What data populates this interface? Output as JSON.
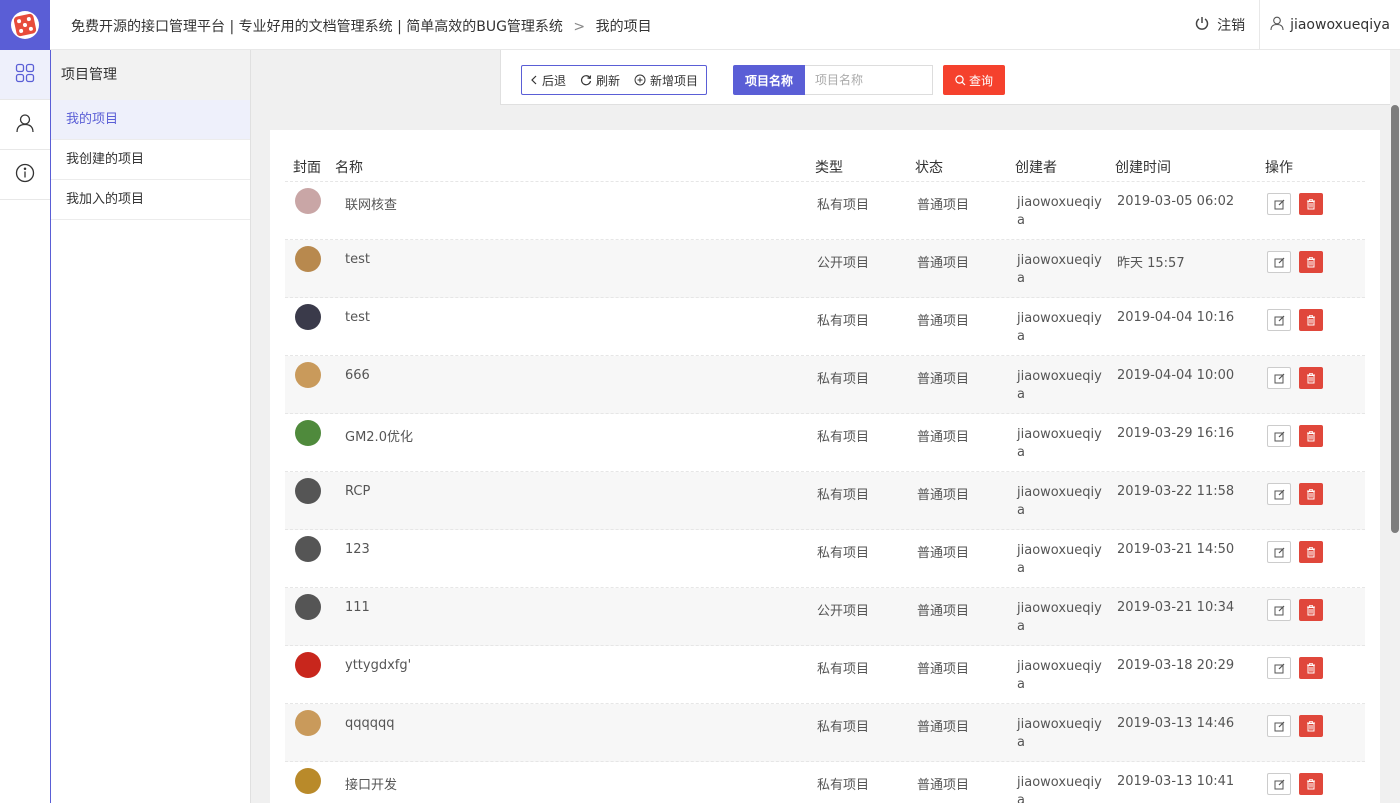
{
  "header": {
    "breadcrumb_site": "免费开源的接口管理平台 | 专业好用的文档管理系统 | 简单高效的BUG管理系统",
    "breadcrumb_sep": ">",
    "breadcrumb_current": "我的项目",
    "logout_label": "注销",
    "username": "jiaowoxueqiya",
    "brand_color": "#5a5ed6"
  },
  "rail": {
    "items": [
      {
        "icon": "grid-icon",
        "active": true
      },
      {
        "icon": "user-icon",
        "active": false
      },
      {
        "icon": "info-icon",
        "active": false
      }
    ]
  },
  "sidebar": {
    "title": "项目管理",
    "items": [
      {
        "label": "我的项目",
        "active": true
      },
      {
        "label": "我创建的项目",
        "active": false
      },
      {
        "label": "我加入的项目",
        "active": false
      }
    ]
  },
  "toolbar": {
    "back_label": "后退",
    "refresh_label": "刷新",
    "add_label": "新增项目",
    "search_label": "项目名称",
    "search_placeholder": "项目名称",
    "search_value": "",
    "query_label": "查询",
    "query_color": "#f5412d"
  },
  "table": {
    "columns": {
      "cover": "封面",
      "name": "名称",
      "type": "类型",
      "status": "状态",
      "creator": "创建者",
      "time": "创建时间",
      "ops": "操作"
    },
    "rows": [
      {
        "name": "联网核查",
        "type": "私有项目",
        "status": "普通项目",
        "creator": "jiaowoxueqiya",
        "time": "2019-03-05 06:02",
        "avatar_color": "#c9a6a6"
      },
      {
        "name": "test",
        "type": "公开项目",
        "status": "普通项目",
        "creator": "jiaowoxueqiya",
        "time": "昨天 15:57",
        "avatar_color": "#b8894e"
      },
      {
        "name": "test",
        "type": "私有项目",
        "status": "普通项目",
        "creator": "jiaowoxueqiya",
        "time": "2019-04-04 10:16",
        "avatar_color": "#3a3a4a"
      },
      {
        "name": "666",
        "type": "私有项目",
        "status": "普通项目",
        "creator": "jiaowoxueqiya",
        "time": "2019-04-04 10:00",
        "avatar_color": "#c99a5b"
      },
      {
        "name": "GM2.0优化",
        "type": "私有项目",
        "status": "普通项目",
        "creator": "jiaowoxueqiya",
        "time": "2019-03-29 16:16",
        "avatar_color": "#4f8a3c"
      },
      {
        "name": "RCP",
        "type": "私有项目",
        "status": "普通项目",
        "creator": "jiaowoxueqiya",
        "time": "2019-03-22 11:58",
        "avatar_color": "#555555"
      },
      {
        "name": "123",
        "type": "私有项目",
        "status": "普通项目",
        "creator": "jiaowoxueqiya",
        "time": "2019-03-21 14:50",
        "avatar_color": "#555555"
      },
      {
        "name": "111",
        "type": "公开项目",
        "status": "普通项目",
        "creator": "jiaowoxueqiya",
        "time": "2019-03-21 10:34",
        "avatar_color": "#555555"
      },
      {
        "name": "yttygdxfg'",
        "type": "私有项目",
        "status": "普通项目",
        "creator": "jiaowoxueqiya",
        "time": "2019-03-18 20:29",
        "avatar_color": "#c8261c"
      },
      {
        "name": "qqqqqq",
        "type": "私有项目",
        "status": "普通项目",
        "creator": "jiaowoxueqiya",
        "time": "2019-03-13 14:46",
        "avatar_color": "#c99a5b"
      },
      {
        "name": "接口开发",
        "type": "私有项目",
        "status": "普通项目",
        "creator": "jiaowoxueqiya",
        "time": "2019-03-13 10:41",
        "avatar_color": "#b98a2a"
      }
    ]
  }
}
